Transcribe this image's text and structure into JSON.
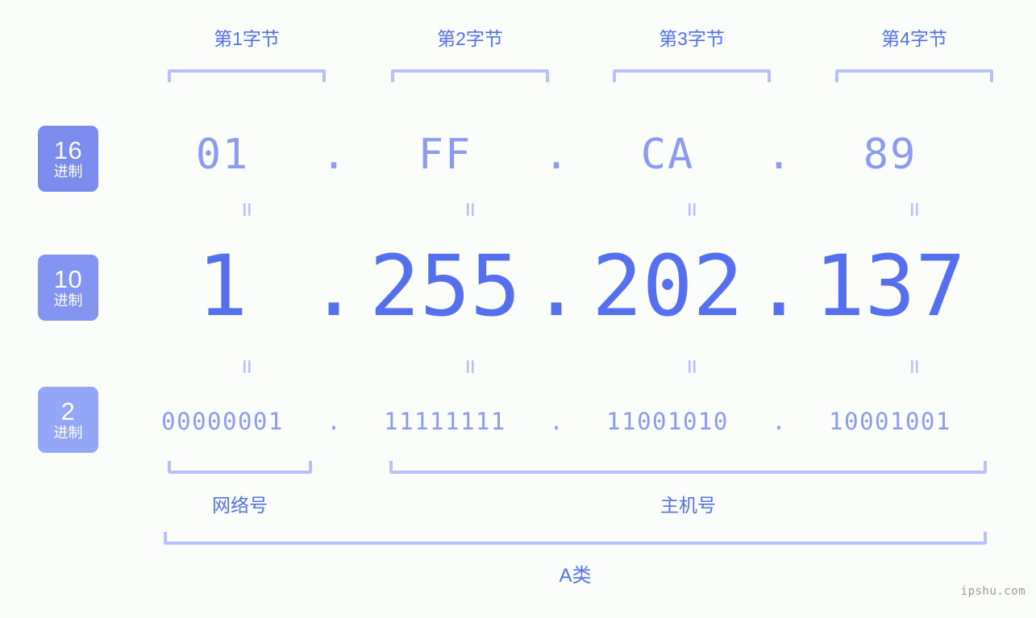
{
  "page": {
    "background_color": "#fbfdfa",
    "accent_color": "#5570ee",
    "light_accent_color": "#8b9bf2",
    "bracket_color": "#b7c0fb",
    "watermark": "ipshu.com"
  },
  "byte_headers": [
    {
      "label": "第1字节"
    },
    {
      "label": "第2字节"
    },
    {
      "label": "第3字节"
    },
    {
      "label": "第4字节"
    }
  ],
  "radix_badges": [
    {
      "number": "16",
      "unit": "进制",
      "color": "#7b8cef"
    },
    {
      "number": "10",
      "unit": "进制",
      "color": "#8295f2"
    },
    {
      "number": "2",
      "unit": "进制",
      "color": "#93a6f7"
    }
  ],
  "rows": {
    "hex": {
      "values": [
        "01",
        "FF",
        "CA",
        "89"
      ],
      "separator": "."
    },
    "decimal": {
      "values": [
        "1",
        "255",
        "202",
        "137"
      ],
      "separator": "."
    },
    "binary": {
      "values": [
        "00000001",
        "11111111",
        "11001010",
        "10001001"
      ],
      "separator": "."
    }
  },
  "equals_marker": "=",
  "parts": [
    {
      "label": "网络号"
    },
    {
      "label": "主机号"
    }
  ],
  "ip_class": {
    "label": "A类"
  }
}
